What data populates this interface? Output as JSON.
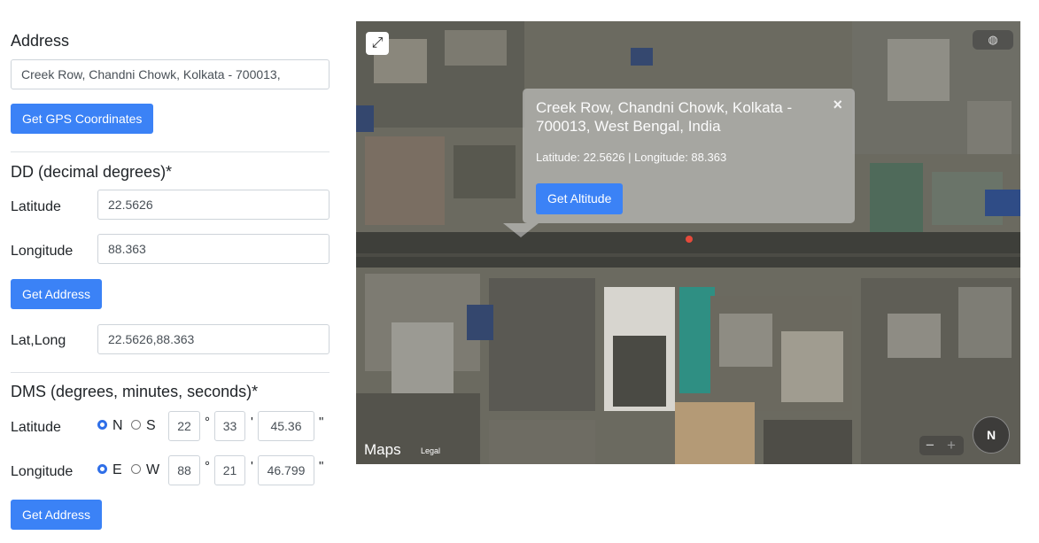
{
  "address": {
    "heading": "Address",
    "value": "Creek Row, Chandni Chowk, Kolkata - 700013,",
    "gps_button": "Get GPS Coordinates"
  },
  "dd": {
    "heading": "DD (decimal degrees)*",
    "lat_label": "Latitude",
    "lat_value": "22.5626",
    "lng_label": "Longitude",
    "lng_value": "88.363",
    "get_address_button": "Get Address",
    "latlong_label": "Lat,Long",
    "latlong_value": "22.5626,88.363"
  },
  "dms": {
    "heading": "DMS (degrees, minutes, seconds)*",
    "lat_label": "Latitude",
    "lat_n": "N",
    "lat_s": "S",
    "lat_deg": "22",
    "lat_min": "33",
    "lat_sec": "45.36",
    "lng_label": "Longitude",
    "lng_e": "E",
    "lng_w": "W",
    "lng_deg": "88",
    "lng_min": "21",
    "lng_sec": "46.799",
    "deg_sym": "°",
    "min_sym": "'",
    "sec_sym": "\"",
    "get_address_button": "Get Address"
  },
  "map": {
    "popup_title": "Creek Row, Chandni Chowk, Kolkata - 700013, West Bengal, India",
    "popup_coords": "Latitude: 22.5626 | Longitude: 88.363",
    "popup_button": "Get Altitude",
    "close": "×",
    "maps_brand": "Maps",
    "legal": "Legal",
    "compass": "N",
    "zoom_out": "−",
    "zoom_in": "+"
  }
}
